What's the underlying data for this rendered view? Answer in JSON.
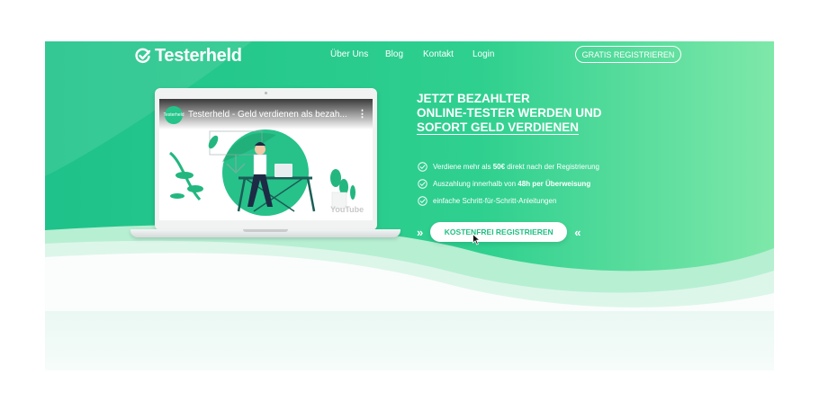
{
  "brand": {
    "name": "Testerheld"
  },
  "nav": {
    "links": [
      "Über Uns",
      "Blog",
      "Kontakt",
      "Login"
    ],
    "cta": "GRATIS REGISTRIEREN"
  },
  "video": {
    "logo_text": "Testerheld",
    "title": "Testerheld - Geld verdienen als bezah...",
    "platform": "YouTube"
  },
  "hero": {
    "headline_line1": "JETZT BEZAHLTER",
    "headline_line2": "ONLINE-TESTER WERDEN UND",
    "headline_line3": "SOFORT GELD VERDIENEN",
    "features": [
      {
        "pre": "Verdiene mehr als ",
        "bold": "50€",
        "post": " direkt nach der Registrierung"
      },
      {
        "pre": "Auszahlung innerhalb von ",
        "bold": "48h per Überweisung",
        "post": ""
      },
      {
        "pre": "einfache Schritt-für-Schritt-Anleitungen",
        "bold": "",
        "post": ""
      }
    ],
    "cta": "KOSTENFREI REGISTRIEREN",
    "chevron_left": "»",
    "chevron_right": "«"
  },
  "colors": {
    "primary": "#24c48a",
    "light": "#6ee7a6",
    "pale": "#e6f7f1"
  },
  "icons": {
    "logo": "check-circle-icon",
    "feature": "check-circle-icon",
    "menu": "vertical-dots-icon"
  }
}
